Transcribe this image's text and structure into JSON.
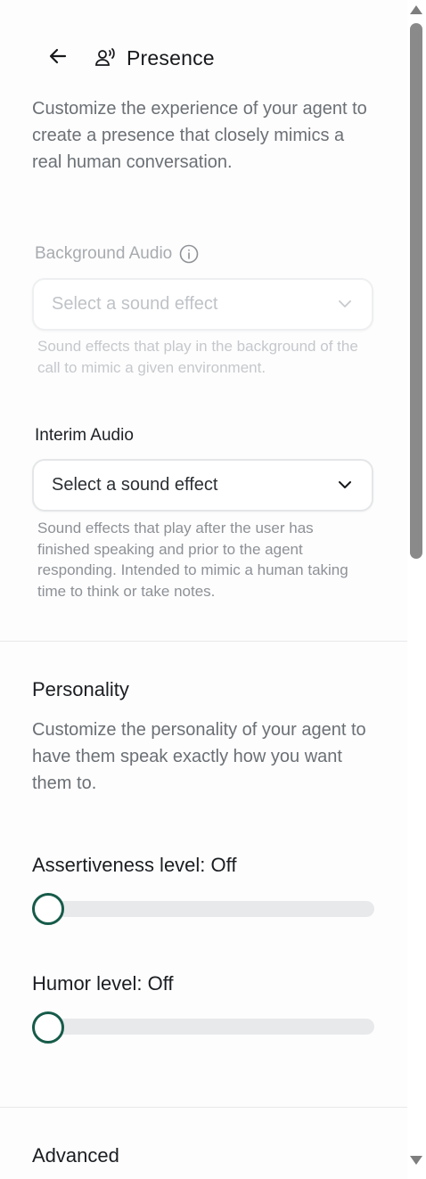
{
  "header": {
    "back_icon": "arrow-left-icon",
    "section_icon": "person-speaking-icon",
    "title": "Presence"
  },
  "presence": {
    "description": "Customize the experience of your agent to create a presence that closely mimics a real human conversation.",
    "background_audio": {
      "label": "Background Audio",
      "info_icon": "info-icon",
      "placeholder": "Select a sound effect",
      "disabled": true,
      "help": "Sound effects that play in the background of the call to mimic a given environment."
    },
    "interim_audio": {
      "label": "Interim Audio",
      "placeholder": "Select a sound effect",
      "help": "Sound effects that play after the user has finished speaking and prior to the agent responding. Intended to mimic a human taking time to think or take notes."
    }
  },
  "personality": {
    "title": "Personality",
    "description": "Customize the personality of your agent to have them speak exactly how you want them to.",
    "assertiveness": {
      "label": "Assertiveness level: Off",
      "level": 0
    },
    "humor": {
      "label": "Humor level: Off",
      "level": 0
    }
  },
  "advanced": {
    "title": "Advanced"
  },
  "colors": {
    "accent": "#165b49",
    "track": "#e8e9eb",
    "muted_text": "#6b7075"
  }
}
